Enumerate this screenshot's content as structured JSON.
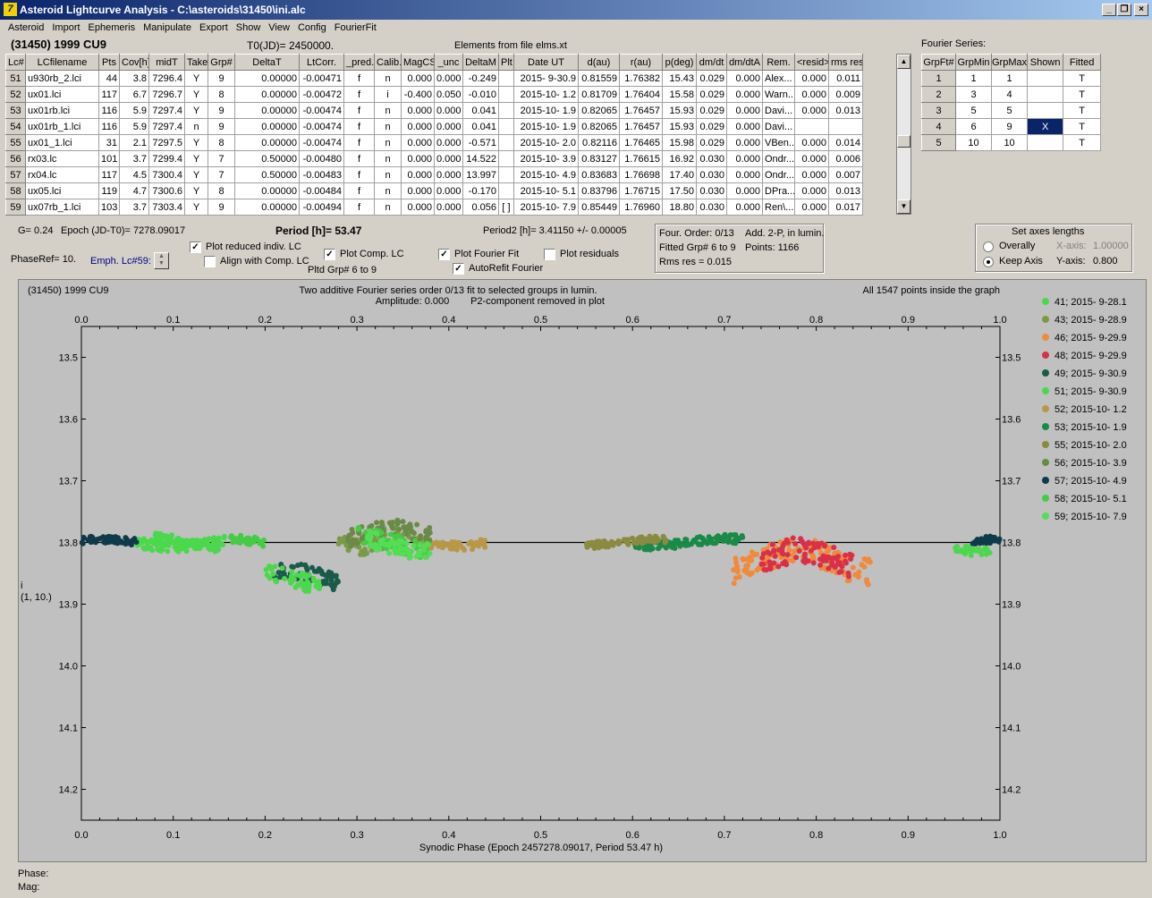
{
  "window": {
    "title": "Asteroid Lightcurve Analysis - C:\\asteroids\\31450\\ini.alc"
  },
  "menu": [
    "Asteroid",
    "Import",
    "Ephemeris",
    "Manipulate",
    "Export",
    "Show",
    "View",
    "Config",
    "FourierFit"
  ],
  "header": {
    "asteroid": "(31450) 1999 CU9",
    "t0": "T0(JD)= 2450000.",
    "elements": "Elements from file elms.xt",
    "fourier_title": "Fourier Series:"
  },
  "lc_table": {
    "columns": [
      "Lc#",
      "LCfilename",
      "Pts",
      "Cov[h]",
      "midT",
      "Take",
      "Grp#",
      "DeltaT",
      "LtCorr.",
      "_pred.",
      "Calib.",
      "MagCS",
      "_unc",
      "DeltaM",
      "Plt",
      "Date UT",
      "d(au)",
      "r(au)",
      "p(deg)",
      "dm/dt",
      "dm/dtA",
      "Rem.",
      "<resid>",
      "rms res"
    ],
    "rows": [
      [
        "51",
        "u930rb_2.lci",
        "44",
        "3.8",
        "7296.4",
        "Y",
        "9",
        "0.00000",
        "-0.00471",
        "f",
        "n",
        "0.000",
        "0.000",
        "-0.249",
        "",
        "2015- 9-30.9",
        "0.81559",
        "1.76382",
        "15.43",
        "0.029",
        "0.000",
        "Alex...",
        "0.000",
        "0.011"
      ],
      [
        "52",
        "ux01.lci",
        "117",
        "6.7",
        "7296.7",
        "Y",
        "8",
        "0.00000",
        "-0.00472",
        "f",
        "i",
        "-0.400",
        "0.050",
        "-0.010",
        "",
        "2015-10- 1.2",
        "0.81709",
        "1.76404",
        "15.58",
        "0.029",
        "0.000",
        "Warn...",
        "0.000",
        "0.009"
      ],
      [
        "53",
        "ux01rb.lci",
        "116",
        "5.9",
        "7297.4",
        "Y",
        "9",
        "0.00000",
        "-0.00474",
        "f",
        "n",
        "0.000",
        "0.000",
        "0.041",
        "",
        "2015-10- 1.9",
        "0.82065",
        "1.76457",
        "15.93",
        "0.029",
        "0.000",
        "Davi...",
        "0.000",
        "0.013"
      ],
      [
        "54",
        "ux01rb_1.lci",
        "116",
        "5.9",
        "7297.4",
        "n",
        "9",
        "0.00000",
        "-0.00474",
        "f",
        "n",
        "0.000",
        "0.000",
        "0.041",
        "",
        "2015-10- 1.9",
        "0.82065",
        "1.76457",
        "15.93",
        "0.029",
        "0.000",
        "Davi...",
        "",
        ""
      ],
      [
        "55",
        "ux01_1.lci",
        "31",
        "2.1",
        "7297.5",
        "Y",
        "8",
        "0.00000",
        "-0.00474",
        "f",
        "n",
        "0.000",
        "0.000",
        "-0.571",
        "",
        "2015-10- 2.0",
        "0.82116",
        "1.76465",
        "15.98",
        "0.029",
        "0.000",
        "VBen...",
        "0.000",
        "0.014"
      ],
      [
        "56",
        "rx03.lc",
        "101",
        "3.7",
        "7299.4",
        "Y",
        "7",
        "0.50000",
        "-0.00480",
        "f",
        "n",
        "0.000",
        "0.000",
        "14.522",
        "",
        "2015-10- 3.9",
        "0.83127",
        "1.76615",
        "16.92",
        "0.030",
        "0.000",
        "Ondr...",
        "0.000",
        "0.006"
      ],
      [
        "57",
        "rx04.lc",
        "117",
        "4.5",
        "7300.4",
        "Y",
        "7",
        "0.50000",
        "-0.00483",
        "f",
        "n",
        "0.000",
        "0.000",
        "13.997",
        "",
        "2015-10- 4.9",
        "0.83683",
        "1.76698",
        "17.40",
        "0.030",
        "0.000",
        "Ondr...",
        "0.000",
        "0.007"
      ],
      [
        "58",
        "ux05.lci",
        "119",
        "4.7",
        "7300.6",
        "Y",
        "8",
        "0.00000",
        "-0.00484",
        "f",
        "n",
        "0.000",
        "0.000",
        "-0.170",
        "",
        "2015-10- 5.1",
        "0.83796",
        "1.76715",
        "17.50",
        "0.030",
        "0.000",
        "DPra...",
        "0.000",
        "0.013"
      ],
      [
        "59",
        "ux07rb_1.lci",
        "103",
        "3.7",
        "7303.4",
        "Y",
        "9",
        "0.00000",
        "-0.00494",
        "f",
        "n",
        "0.000",
        "0.000",
        "0.056",
        "[ ]",
        "2015-10- 7.9",
        "0.85449",
        "1.76960",
        "18.80",
        "0.030",
        "0.000",
        "Ren\\...",
        "0.000",
        "0.017"
      ]
    ]
  },
  "fourier_table": {
    "columns": [
      "GrpFt#",
      "GrpMin",
      "GrpMax",
      "Shown",
      "Fitted"
    ],
    "rows": [
      [
        "1",
        "1",
        "1",
        "",
        "T"
      ],
      [
        "2",
        "3",
        "4",
        "",
        "T"
      ],
      [
        "3",
        "5",
        "5",
        "",
        "T"
      ],
      [
        "4",
        "6",
        "9",
        "X",
        "T"
      ],
      [
        "5",
        "10",
        "10",
        "",
        "T"
      ]
    ]
  },
  "controls": {
    "g": "G= 0.24",
    "epoch": "Epoch (JD-T0)= 7278.09017",
    "period": "Period [h]= 53.47",
    "period2": "Period2 [h]= 3.41150 +/- 0.00005",
    "phaseref": "PhaseRef= 10.",
    "emph": "Emph. Lc#59:",
    "plot_reduced": {
      "label": "Plot reduced indiv. LC",
      "checked": true
    },
    "align": {
      "label": "Align with Comp. LC",
      "checked": false
    },
    "plot_comp": {
      "label": "Plot Comp. LC",
      "checked": true
    },
    "pltd_grp": "Pltd Grp#  6  to   9",
    "plot_fourier": {
      "label": "Plot Fourier Fit",
      "checked": true
    },
    "autorefit": {
      "label": "AutoRefit Fourier",
      "checked": true
    },
    "plot_resid": {
      "label": "Plot residuals",
      "checked": false
    }
  },
  "fourier_info": {
    "order": "Four. Order:  0/13",
    "add": "Add. 2-P, in lumin.",
    "fitted": "Fitted Grp# 6 to 9",
    "points": "Points: 1166",
    "rms": "Rms res     = 0.015"
  },
  "axes_box": {
    "title": "Set axes lengths",
    "overally": "Overally",
    "keep_axis": "Keep Axis",
    "selected": "keep_axis",
    "xaxis_label": "X-axis:",
    "xaxis_value": "1.00000",
    "yaxis_label": "Y-axis:",
    "yaxis_value": "0.800"
  },
  "plot": {
    "top_left": "(31450) 1999 CU9",
    "top_center1": "Two additive Fourier series order 0/13 fit to selected groups in lumin.",
    "top_center2": "Amplitude: 0.000",
    "top_center3": "P2-component removed in plot",
    "top_right": "All 1547 points inside the graph",
    "ylabel1": "i",
    "ylabel2": "(1, 10.)"
  },
  "status": {
    "phase": "Phase:",
    "mag": "Mag:"
  },
  "chart_data": {
    "type": "scatter",
    "xlabel": "Synodic Phase (Epoch 2457278.09017, Period 53.47 h)",
    "ylabel": "i (1, 10.)",
    "xlim": [
      0.0,
      1.0
    ],
    "ylim": [
      14.25,
      13.45
    ],
    "xticks": [
      "0.0",
      "0.1",
      "0.2",
      "0.3",
      "0.4",
      "0.5",
      "0.6",
      "0.7",
      "0.8",
      "0.9",
      "1.0"
    ],
    "yticks": [
      "13.5",
      "13.6",
      "13.7",
      "13.8",
      "13.9",
      "14.0",
      "14.1",
      "14.2"
    ],
    "fit_line": 13.8,
    "series": [
      {
        "name": "41; 2015- 9-28.1",
        "color": "#4cd84c",
        "segments": [
          [
            0.06,
            0.16,
            13.8,
            0.012
          ],
          [
            0.95,
            0.99,
            13.81,
            0.01
          ]
        ]
      },
      {
        "name": "43; 2015- 9-28.9",
        "color": "#7a9a48",
        "segments": [
          [
            0.28,
            0.36,
            13.79,
            0.025
          ]
        ]
      },
      {
        "name": "46; 2015- 9-29.9",
        "color": "#f08a3c",
        "segments": [
          [
            0.71,
            0.86,
            13.83,
            0.03
          ]
        ]
      },
      {
        "name": "48; 2015- 9-29.9",
        "color": "#d83048",
        "segments": [
          [
            0.74,
            0.84,
            13.83,
            0.03
          ]
        ]
      },
      {
        "name": "49; 2015- 9-30.9",
        "color": "#1a5a48",
        "segments": [
          [
            0.21,
            0.28,
            13.86,
            0.02
          ]
        ]
      },
      {
        "name": "51; 2015- 9-30.9",
        "color": "#4cd84c",
        "segments": [
          [
            0.2,
            0.26,
            13.86,
            0.02
          ],
          [
            0.08,
            0.15,
            13.8,
            0.012
          ]
        ]
      },
      {
        "name": "52; 2015-10- 1.2",
        "color": "#b89848",
        "segments": [
          [
            0.36,
            0.44,
            13.8,
            0.01
          ]
        ]
      },
      {
        "name": "53; 2015-10- 1.9",
        "color": "#1a8a48",
        "segments": [
          [
            0.6,
            0.72,
            13.8,
            0.01
          ]
        ]
      },
      {
        "name": "55; 2015-10- 2.0",
        "color": "#8a8a40",
        "segments": [
          [
            0.55,
            0.64,
            13.8,
            0.008
          ]
        ]
      },
      {
        "name": "56; 2015-10- 3.9",
        "color": "#6a8a48",
        "segments": [
          [
            0.29,
            0.38,
            13.79,
            0.02
          ]
        ]
      },
      {
        "name": "57; 2015-10- 4.9",
        "color": "#0e3a4a",
        "segments": [
          [
            0.0,
            0.06,
            13.8,
            0.008
          ],
          [
            0.97,
            1.0,
            13.8,
            0.008
          ]
        ]
      },
      {
        "name": "58; 2015-10- 5.1",
        "color": "#44cc44",
        "segments": [
          [
            0.16,
            0.2,
            13.8,
            0.01
          ],
          [
            0.3,
            0.38,
            13.8,
            0.02
          ]
        ]
      },
      {
        "name": "59; 2015-10- 7.9",
        "color": "#55dd55",
        "segments": [
          [
            0.31,
            0.38,
            13.8,
            0.02
          ]
        ]
      }
    ]
  }
}
